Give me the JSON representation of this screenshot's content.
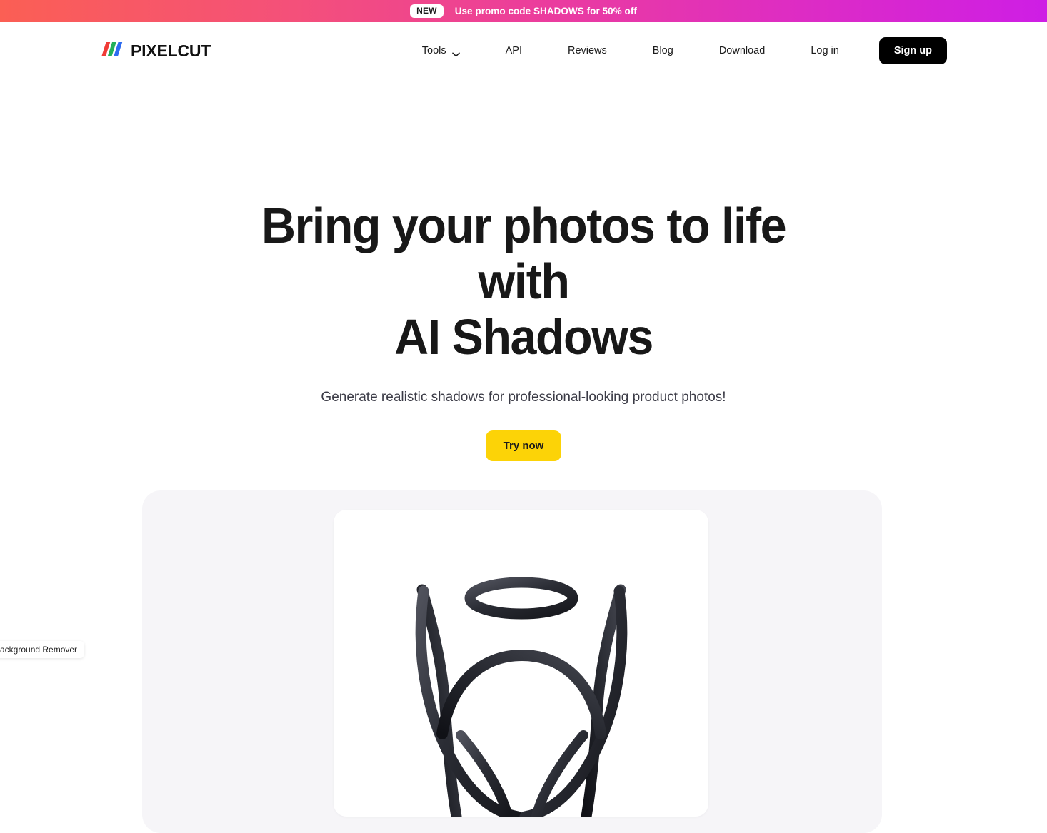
{
  "banner": {
    "badge": "NEW",
    "message": "Use promo code SHADOWS for 50% off",
    "gradient_from": "#FB5F54",
    "gradient_mid": "#EC3E9A",
    "gradient_to": "#CE1EE5"
  },
  "header": {
    "brand_name": "PIXELCUT",
    "logo_colors": [
      "#F03B36",
      "#23B05A",
      "#2D6BF0"
    ],
    "nav": [
      {
        "label": "Tools",
        "has_dropdown": true
      },
      {
        "label": "API",
        "has_dropdown": false
      },
      {
        "label": "Reviews",
        "has_dropdown": false
      },
      {
        "label": "Blog",
        "has_dropdown": false
      },
      {
        "label": "Download",
        "has_dropdown": false
      },
      {
        "label": "Log in",
        "has_dropdown": false
      }
    ],
    "signup_label": "Sign up"
  },
  "hero": {
    "title_line1": "Bring your photos to life with",
    "title_line2": "AI Shadows",
    "subtitle": "Generate realistic shadows for professional-looking product photos!",
    "cta_label": "Try now",
    "cta_color": "#FCD307"
  },
  "showcase": {
    "panel_color": "#F6F5F8",
    "card_color": "#FFFFFF",
    "product_alt": "coiled black cable product photo"
  },
  "status_chip": {
    "text": "Background Remover"
  }
}
